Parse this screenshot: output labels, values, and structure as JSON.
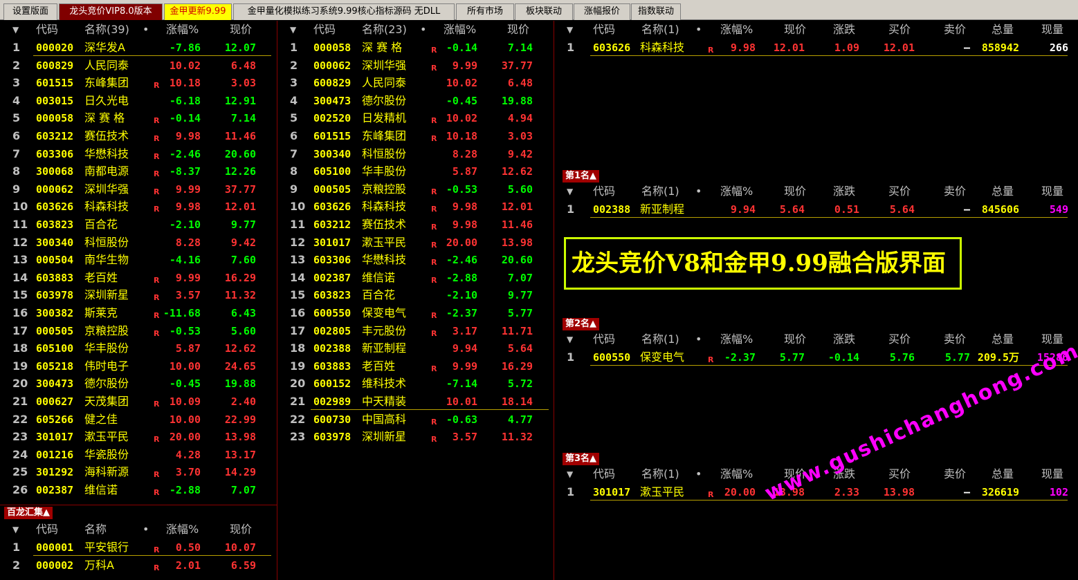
{
  "tabs": [
    {
      "label": "设置版面",
      "state": "normal"
    },
    {
      "label": "龙头竞价VIP8.0版本",
      "state": "active"
    },
    {
      "label": "金甲更新9.99",
      "state": "yellow"
    },
    {
      "label": "金甲量化模拟练习系统9.99核心指标源码 无DLL",
      "state": "normal"
    },
    {
      "label": "所有市场",
      "state": "normal"
    },
    {
      "label": "板块联动",
      "state": "normal"
    },
    {
      "label": "涨幅报价",
      "state": "normal"
    },
    {
      "label": "指数联动",
      "state": "normal"
    }
  ],
  "headers": {
    "arrow": "▼",
    "code": "代码",
    "pct": "涨幅%",
    "price": "现价",
    "change": "涨跌",
    "bid": "买价",
    "ask": "卖价",
    "volume": "总量",
    "cur_vol": "现量",
    "dot": "•"
  },
  "left_panel": {
    "name_header": "名称(39)",
    "rows": [
      [
        "1",
        "000020",
        "深华发A",
        "",
        "-7.86",
        "12.07"
      ],
      [
        "2",
        "600829",
        "人民同泰",
        "",
        "10.02",
        "6.48"
      ],
      [
        "3",
        "601515",
        "东峰集团",
        "R",
        "10.18",
        "3.03"
      ],
      [
        "4",
        "003015",
        "日久光电",
        "",
        "-6.18",
        "12.91"
      ],
      [
        "5",
        "000058",
        "深 赛 格",
        "R",
        "-0.14",
        "7.14"
      ],
      [
        "6",
        "603212",
        "赛伍技术",
        "R",
        "9.98",
        "11.46"
      ],
      [
        "7",
        "603306",
        "华懋科技",
        "R",
        "-2.46",
        "20.60"
      ],
      [
        "8",
        "300068",
        "南都电源",
        "R",
        "-8.37",
        "12.26"
      ],
      [
        "9",
        "000062",
        "深圳华强",
        "R",
        "9.99",
        "37.77"
      ],
      [
        "10",
        "603626",
        "科森科技",
        "R",
        "9.98",
        "12.01"
      ],
      [
        "11",
        "603823",
        "百合花",
        "",
        "-2.10",
        "9.77"
      ],
      [
        "12",
        "300340",
        "科恒股份",
        "",
        "8.28",
        "9.42"
      ],
      [
        "13",
        "000504",
        "南华生物",
        "",
        "-4.16",
        "7.60"
      ],
      [
        "14",
        "603883",
        "老百姓",
        "R",
        "9.99",
        "16.29"
      ],
      [
        "15",
        "603978",
        "深圳新星",
        "R",
        "3.57",
        "11.32"
      ],
      [
        "16",
        "300382",
        "斯莱克",
        "R",
        "-11.68",
        "6.43"
      ],
      [
        "17",
        "000505",
        "京粮控股",
        "R",
        "-0.53",
        "5.60"
      ],
      [
        "18",
        "605100",
        "华丰股份",
        "",
        "5.87",
        "12.62"
      ],
      [
        "19",
        "605218",
        "伟时电子",
        "",
        "10.00",
        "24.65"
      ],
      [
        "20",
        "300473",
        "德尔股份",
        "",
        "-0.45",
        "19.88"
      ],
      [
        "21",
        "000627",
        "天茂集团",
        "R",
        "10.09",
        "2.40"
      ],
      [
        "22",
        "605266",
        "健之佳",
        "",
        "10.00",
        "22.99"
      ],
      [
        "23",
        "301017",
        "漱玉平民",
        "R",
        "20.00",
        "13.98"
      ],
      [
        "24",
        "001216",
        "华瓷股份",
        "",
        "4.28",
        "13.17"
      ],
      [
        "25",
        "301292",
        "海科新源",
        "R",
        "3.70",
        "14.29"
      ],
      [
        "26",
        "002387",
        "维信诺",
        "R",
        "-2.88",
        "7.07"
      ]
    ]
  },
  "bailong": {
    "label": "百龙汇集▲",
    "name_header": "名称",
    "rows": [
      [
        "1",
        "000001",
        "平安银行",
        "R",
        "0.50",
        "10.07"
      ],
      [
        "2",
        "000002",
        "万科A",
        "R",
        "2.01",
        "6.59"
      ]
    ]
  },
  "mid_panel": {
    "name_header": "名称(23)",
    "rows": [
      [
        "1",
        "000058",
        "深 赛 格",
        "R",
        "-0.14",
        "7.14"
      ],
      [
        "2",
        "000062",
        "深圳华强",
        "R",
        "9.99",
        "37.77"
      ],
      [
        "3",
        "600829",
        "人民同泰",
        "",
        "10.02",
        "6.48"
      ],
      [
        "4",
        "300473",
        "德尔股份",
        "",
        "-0.45",
        "19.88"
      ],
      [
        "5",
        "002520",
        "日发精机",
        "R",
        "10.02",
        "4.94"
      ],
      [
        "6",
        "601515",
        "东峰集团",
        "R",
        "10.18",
        "3.03"
      ],
      [
        "7",
        "300340",
        "科恒股份",
        "",
        "8.28",
        "9.42"
      ],
      [
        "8",
        "605100",
        "华丰股份",
        "",
        "5.87",
        "12.62"
      ],
      [
        "9",
        "000505",
        "京粮控股",
        "R",
        "-0.53",
        "5.60"
      ],
      [
        "10",
        "603626",
        "科森科技",
        "R",
        "9.98",
        "12.01"
      ],
      [
        "11",
        "603212",
        "赛伍技术",
        "R",
        "9.98",
        "11.46"
      ],
      [
        "12",
        "301017",
        "漱玉平民",
        "R",
        "20.00",
        "13.98"
      ],
      [
        "13",
        "603306",
        "华懋科技",
        "R",
        "-2.46",
        "20.60"
      ],
      [
        "14",
        "002387",
        "维信诺",
        "R",
        "-2.88",
        "7.07"
      ],
      [
        "15",
        "603823",
        "百合花",
        "",
        "-2.10",
        "9.77"
      ],
      [
        "16",
        "600550",
        "保变电气",
        "R",
        "-2.37",
        "5.77"
      ],
      [
        "17",
        "002805",
        "丰元股份",
        "R",
        "3.17",
        "11.71"
      ],
      [
        "18",
        "002388",
        "新亚制程",
        "",
        "9.94",
        "5.64"
      ],
      [
        "19",
        "603883",
        "老百姓",
        "R",
        "9.99",
        "16.29"
      ],
      [
        "20",
        "600152",
        "维科技术",
        "",
        "-7.14",
        "5.72"
      ],
      [
        "21",
        "002989",
        "中天精装",
        "",
        "10.01",
        "18.14"
      ],
      [
        "22",
        "600730",
        "中国高科",
        "R",
        "-0.63",
        "4.77"
      ],
      [
        "23",
        "603978",
        "深圳新星",
        "R",
        "3.57",
        "11.32"
      ]
    ]
  },
  "right_tables": [
    {
      "rank_label": "",
      "name_header": "名称(1)",
      "row": [
        "1",
        "603626",
        "科森科技",
        "R",
        "9.98",
        "12.01",
        "1.09",
        "12.01",
        "—",
        "858942",
        "266"
      ]
    },
    {
      "rank_label": "第1名▲",
      "name_header": "名称(1)",
      "row": [
        "1",
        "002388",
        "新亚制程",
        "",
        "9.94",
        "5.64",
        "0.51",
        "5.64",
        "—",
        "845606",
        "549"
      ]
    },
    {
      "rank_label": "第2名▲",
      "name_header": "名称(1)",
      "row": [
        "1",
        "600550",
        "保变电气",
        "R",
        "-2.37",
        "5.77",
        "-0.14",
        "5.76",
        "5.77",
        "209.5万",
        "15286"
      ]
    },
    {
      "rank_label": "第3名▲",
      "name_header": "名称(1)",
      "row": [
        "1",
        "301017",
        "漱玉平民",
        "R",
        "20.00",
        "13.98",
        "2.33",
        "13.98",
        "—",
        "326619",
        "102"
      ]
    }
  ],
  "banner": "龙头竞价V8和金甲9.99融合版界面",
  "watermark": "www.gushichanghong.com"
}
